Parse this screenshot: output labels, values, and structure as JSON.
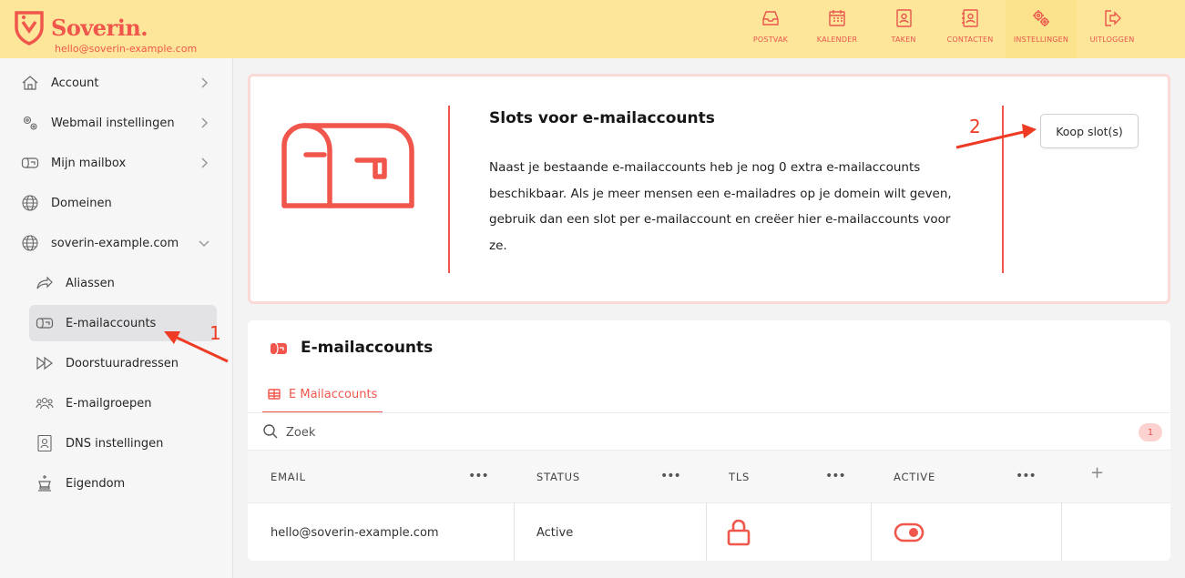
{
  "brand": {
    "name": "Soverin.",
    "email": "hello@soverin-example.com",
    "accent": "#f0564b",
    "header_bg": "#fde69a"
  },
  "nav": [
    {
      "label": "POSTVAK",
      "icon": "inbox-icon"
    },
    {
      "label": "KALENDER",
      "icon": "calendar-icon"
    },
    {
      "label": "TAKEN",
      "icon": "tasks-icon"
    },
    {
      "label": "CONTACTEN",
      "icon": "contacts-icon"
    },
    {
      "label": "INSTELLINGEN",
      "icon": "gear-icon",
      "active": true
    },
    {
      "label": "UITLOGGEN",
      "icon": "logout-icon"
    }
  ],
  "sidebar": {
    "items": [
      {
        "label": "Account",
        "icon": "home-icon"
      },
      {
        "label": "Webmail instellingen",
        "icon": "gears-icon"
      },
      {
        "label": "Mijn mailbox",
        "icon": "mailbox-icon"
      },
      {
        "label": "Domeinen",
        "icon": "globe-icon"
      },
      {
        "label": "soverin-example.com",
        "icon": "globe-icon"
      },
      {
        "label": "Aliassen",
        "icon": "forward-arrow-icon"
      },
      {
        "label": "E-mailaccounts",
        "icon": "mailbox-icon",
        "selected": true
      },
      {
        "label": "Doorstuuradressen",
        "icon": "fast-forward-icon"
      },
      {
        "label": "E-mailgroepen",
        "icon": "users-icon"
      },
      {
        "label": "DNS instellingen",
        "icon": "contact-card-icon"
      },
      {
        "label": "Eigendom",
        "icon": "chess-king-icon"
      }
    ]
  },
  "slots": {
    "title": "Slots voor e-mailaccounts",
    "text": "Naast je bestaande e-mailaccounts heb je nog 0 extra e-mailaccounts beschikbaar. Als je meer mensen een e-mailadres op je domein wilt geven, gebruik dan een slot per e-mailaccount en creëer hier e-mailaccounts voor ze.",
    "button": "Koop slot(s)"
  },
  "accounts": {
    "title": "E-mailaccounts",
    "tab": "E Mailaccounts",
    "search_placeholder": "Zoek",
    "count": "1",
    "columns": [
      "EMAIL",
      "STATUS",
      "TLS",
      "ACTIVE"
    ],
    "rows": [
      {
        "email": "hello@soverin-example.com",
        "status": "Active",
        "tls": "lock-icon",
        "active": true
      }
    ]
  },
  "annotations": {
    "one": "1",
    "two": "2"
  }
}
